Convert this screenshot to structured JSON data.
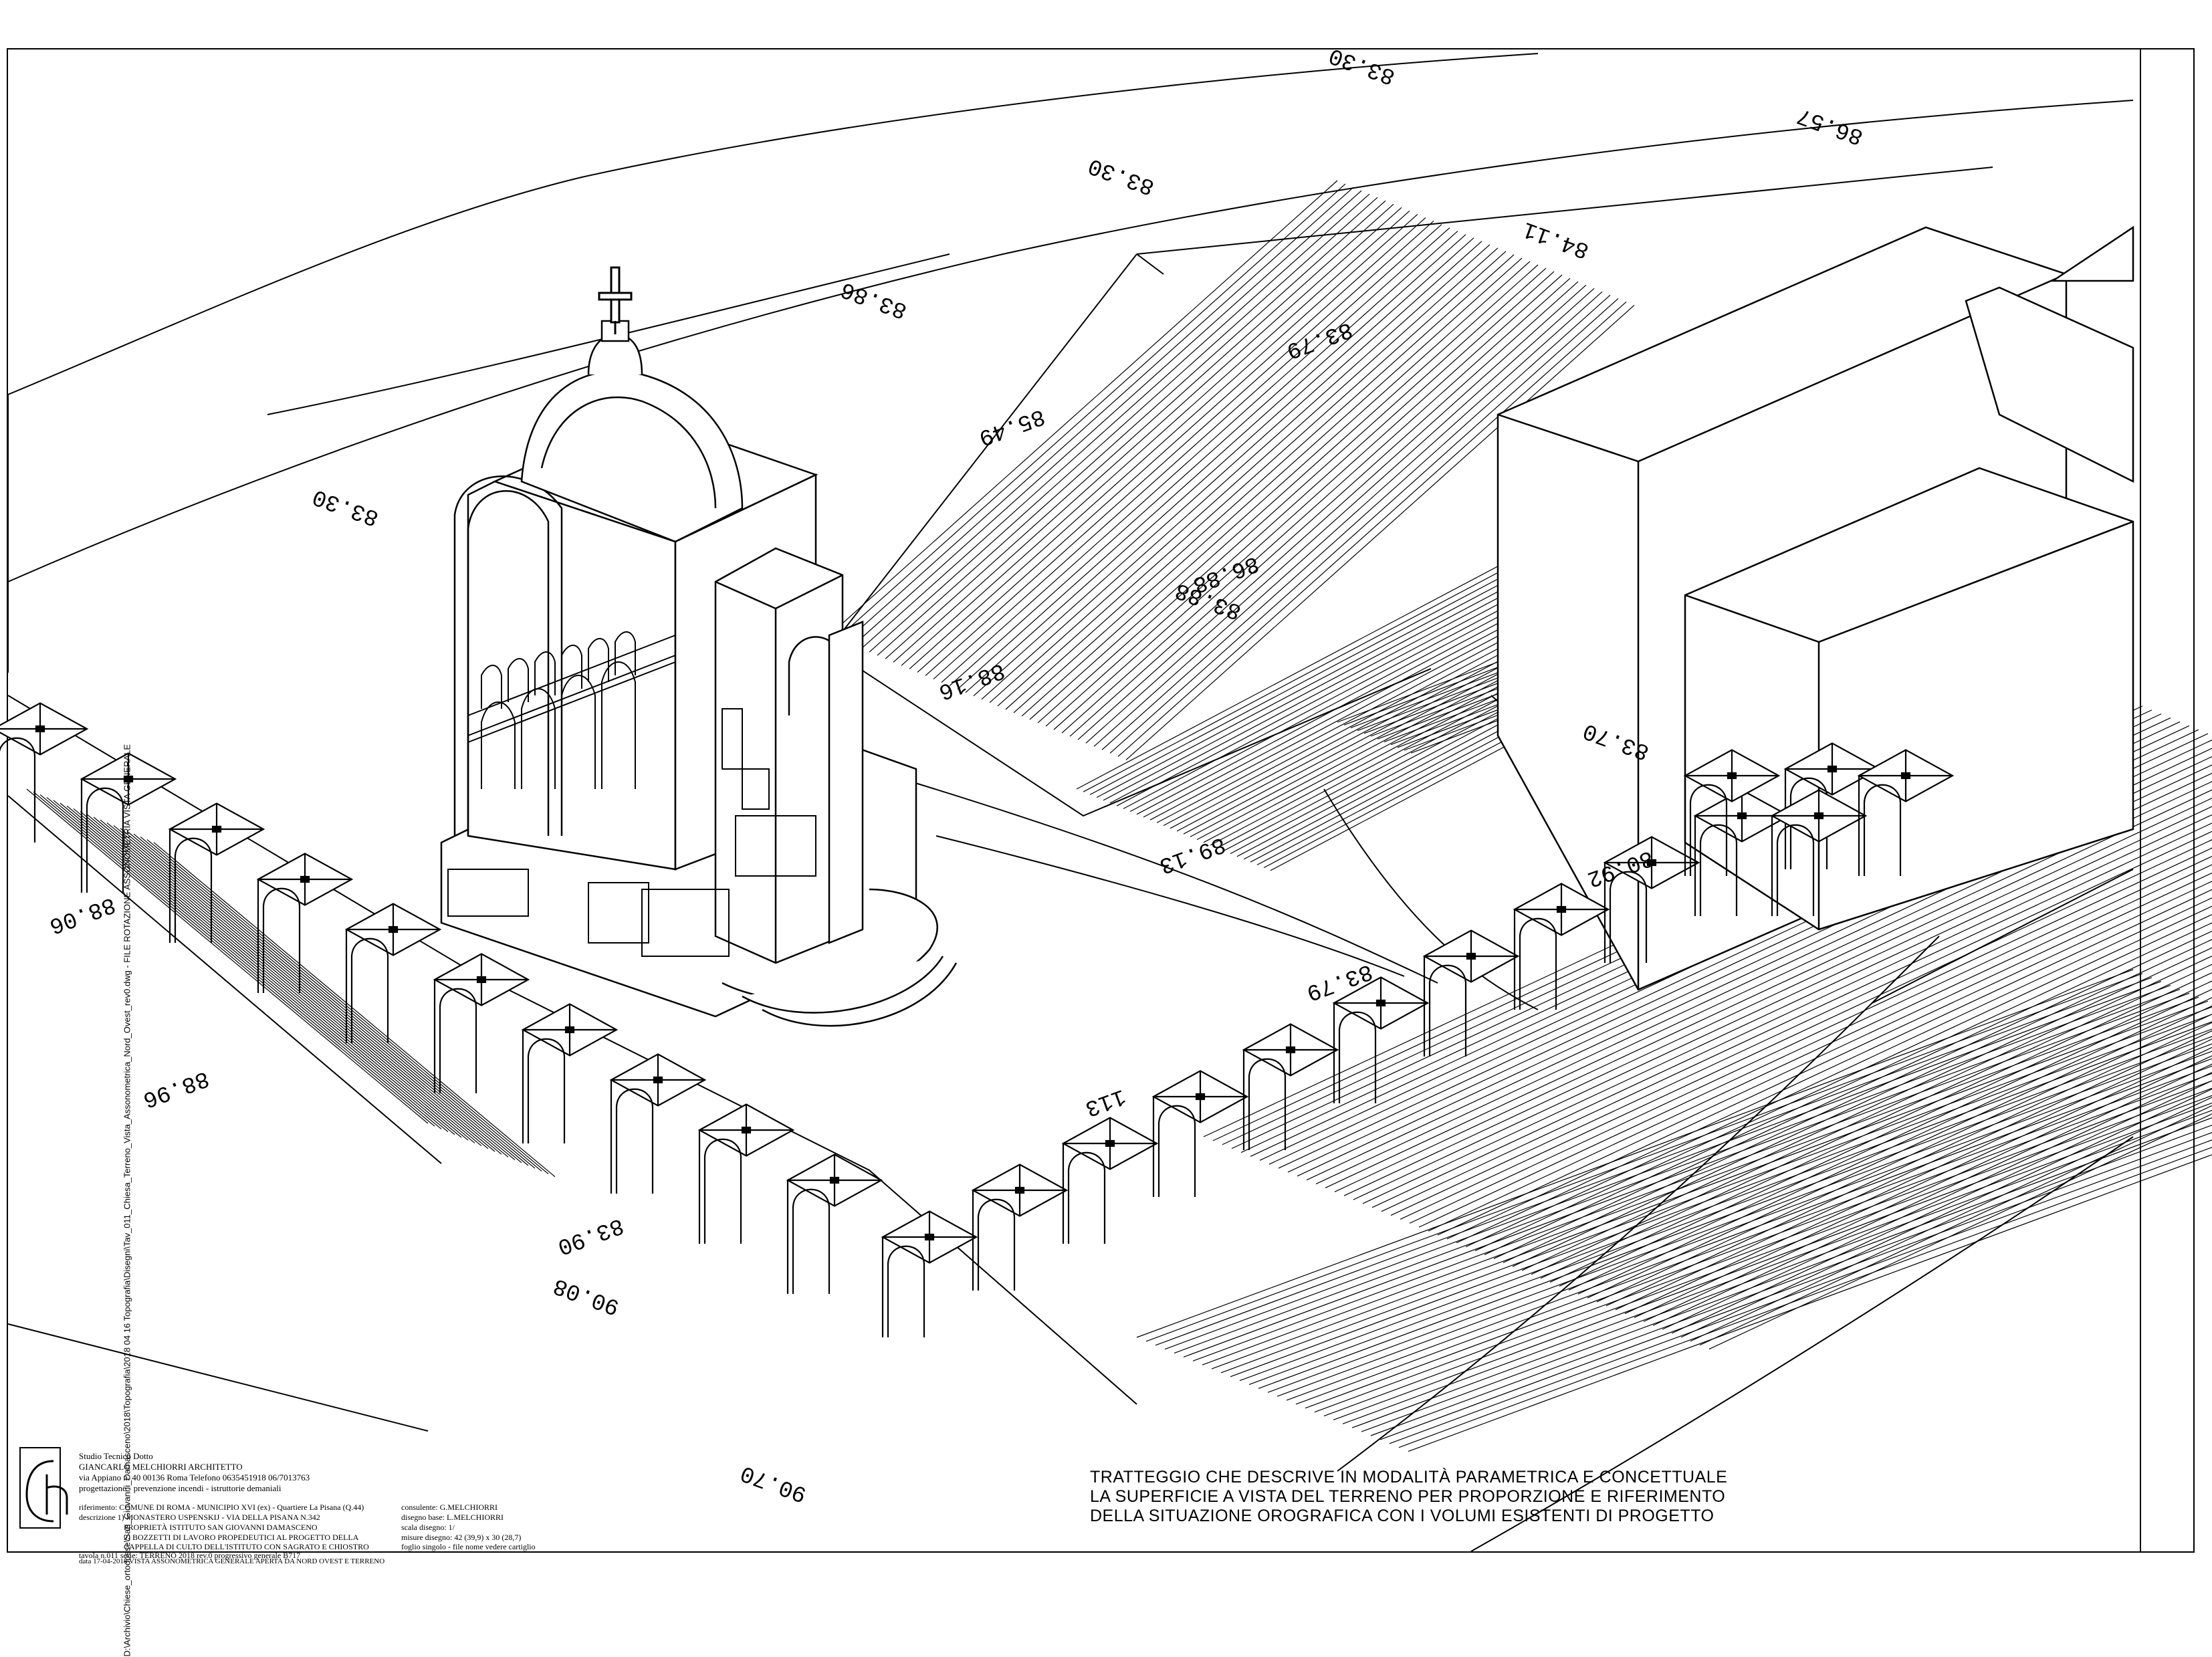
{
  "drawing": {
    "contour_labels": [
      "83.30",
      "83.30",
      "83.86",
      "83.30",
      "83.70",
      "83.88",
      "86.57",
      "84.11",
      "83.79",
      "85.49",
      "86.88",
      "89.13",
      "88.16",
      "83.79",
      "80.92",
      "88.96",
      "88.06",
      "83.90",
      "90.70",
      "90.08",
      "113"
    ],
    "side_path": "D:\\Archivio\\Chiese_ortodosse\\San_Giovanni_Damasceno\\2018\\Topografia\\2018 04 16 Topografia\\Disegni\\Tav_011_Chiesa_Terreno_Vista_Assonometrica_Nord_Ovest_rev0.dwg - FILE ROTAZIONE ASSONOMETRIA VISTA GENERALE"
  },
  "title_block": {
    "studio": "Studio Tecnico Dotto",
    "architect": "GIANCARLO MELCHIORRI ARCHITETTO",
    "address": "via Appiano n. 40   00136 Roma  Telefono 0635451918 06/7013763",
    "roles": "progettazione     -     prevenzione incendi     -     istruttorie demaniali",
    "riferimento": "riferimento:  COMUNE DI ROMA - MUNICIPIO XVI (ex) - Quartiere La Pisana (Q.44)",
    "descrizione": "descrizione 1) MONASTERO USPENSKIJ - VIA DELLA PISANA N.342",
    "proprieta": "PROPRIETÀ ISTITUTO SAN GIOVANNI DAMASCENO",
    "bozzetti": "2) BOZZETTI DI LAVORO PROPEDEUTICI AL PROGETTO DELLA",
    "cappella": "CAPPELLA DI CULTO DELL'ISTITUTO CON SAGRATO E CHIOSTRO",
    "tavola": "tavola n.011   serie: TERRENO 2018 rev.0          progressivo generale B717",
    "data": "data 17-04-2018      VISTA ASSONOMETRICA GENERALE APERTA DA NORD OVEST E TERRENO",
    "consulente": "consulente: G.MELCHIORRI",
    "disegno": "disegno base: L.MELCHIORRI",
    "scala": "scala disegno: 1/",
    "misure": "misure disegno: 42 (39,9) x 30 (28,7)",
    "foglio": "foglio singolo - file nome vedere cartiglio"
  },
  "note": {
    "line1": "TRATTEGGIO CHE DESCRIVE IN MODALITÀ PARAMETRICA E  CONCETTUALE",
    "line2": "LA SUPERFICIE A VISTA DEL TERRENO PER PROPORZIONE E RIFERIMENTO",
    "line3": "DELLA SITUAZIONE OROGRAFICA CON I VOLUMI ESISTENTI DI PROGETTO"
  },
  "icons": {
    "cross": "orthodox-cross-icon",
    "logo": "studio-monogram-logo"
  }
}
